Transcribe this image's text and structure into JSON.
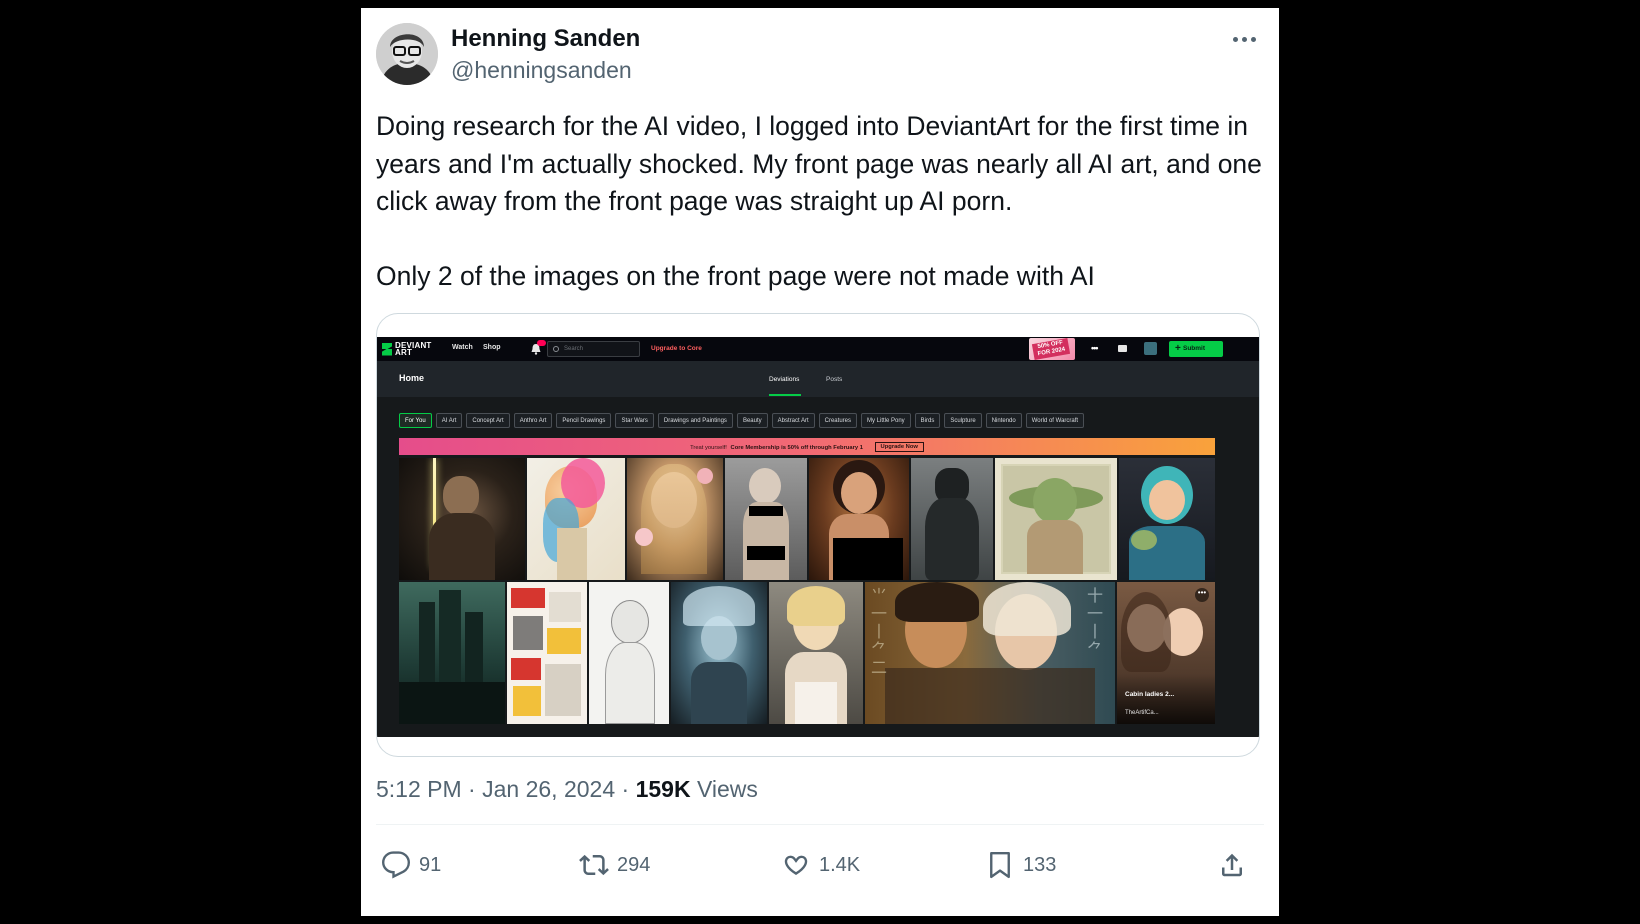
{
  "tweet": {
    "author_name": "Henning Sanden",
    "author_handle": "@henningsanden",
    "text_paragraphs": [
      "Doing research for the AI video, I logged into DeviantArt for the first time in years and I'm actually shocked. My front page was nearly all AI art, and one click away from the front page was straight up AI porn.",
      "Only 2 of the images on the front page were not made with AI"
    ],
    "time": "5:12 PM",
    "date": "Jan 26, 2024",
    "views_count": "159K",
    "views_label": "Views",
    "more_icon": "ellipsis-icon"
  },
  "actions": {
    "replies": "91",
    "retweets": "294",
    "likes": "1.4K",
    "bookmarks": "133",
    "icons": [
      "reply-icon",
      "retweet-icon",
      "like-icon",
      "bookmark-icon",
      "share-icon"
    ]
  },
  "screenshot": {
    "logo": "DEVIANT ART",
    "nav": [
      "Watch",
      "Shop"
    ],
    "search_placeholder": "Search",
    "upgrade": "Upgrade to Core",
    "promo": "50% OFF FOR 2024",
    "submit": "Submit",
    "page_title": "Home",
    "tabs": [
      "Deviations",
      "Posts"
    ],
    "chips": [
      "For You",
      "AI Art",
      "Concept Art",
      "Anthro Art",
      "Pencil Drawings",
      "Star Wars",
      "Drawings and Paintings",
      "Beauty",
      "Abstract Art",
      "Creatures",
      "My Little Pony",
      "Birds",
      "Sculpture",
      "Nintendo",
      "World of Warcraft"
    ],
    "banner_text": "Treat yourself!",
    "banner_bold": "Core Membership is 50% off through February 1",
    "banner_cta": "Upgrade Now",
    "last_tile_title": "Cabin ladies 2...",
    "last_tile_author": "TheArtifCa..."
  },
  "colors": {
    "accent_green": "#05cc47",
    "text_primary": "#0f1419",
    "text_secondary": "#536471"
  }
}
